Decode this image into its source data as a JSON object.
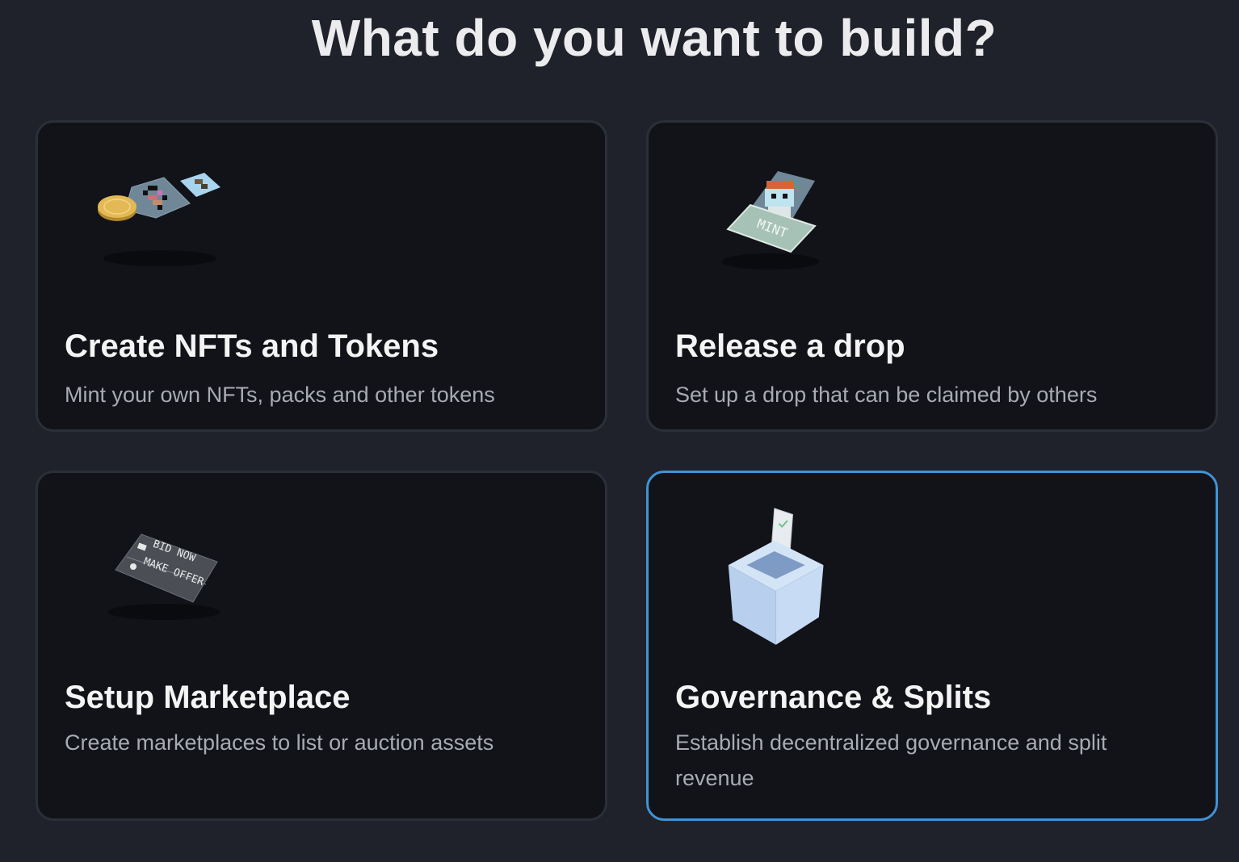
{
  "heading": "What do you want to build?",
  "cards": [
    {
      "title": "Create NFTs and Tokens",
      "description": "Mint your own NFTs, packs and other tokens",
      "icon": "nft-tokens-illustration",
      "selected": false
    },
    {
      "title": "Release a drop",
      "description": "Set up a drop that can be claimed by others",
      "icon": "mint-drop-illustration",
      "mint_label": "MINT",
      "selected": false
    },
    {
      "title": "Setup Marketplace",
      "description": "Create marketplaces to list or auction assets",
      "icon": "marketplace-illustration",
      "bid_label": "BID NOW",
      "offer_label": "MAKE OFFER",
      "selected": false
    },
    {
      "title": "Governance & Splits",
      "description": "Establish decentralized governance and split revenue",
      "icon": "ballot-box-illustration",
      "selected": true
    }
  ],
  "colors": {
    "background": "#1f222a",
    "card": "#111318",
    "card_border": "#2b2f38",
    "selected_border": "#3f93d6"
  }
}
